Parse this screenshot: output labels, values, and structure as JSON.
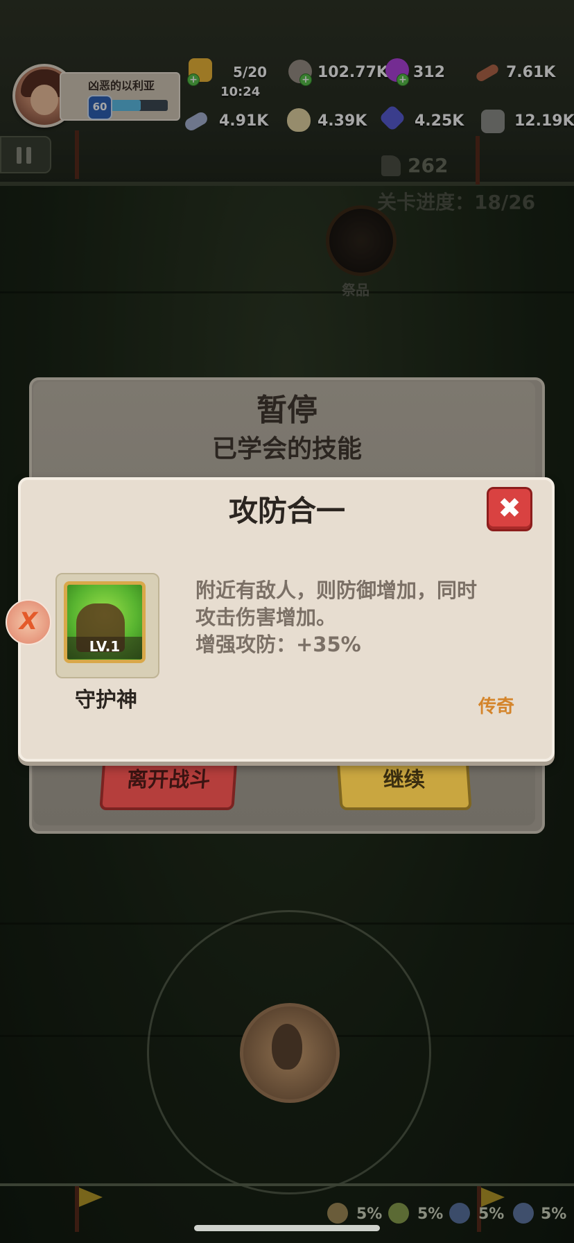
{
  "player": {
    "name": "凶恶的以利亚",
    "level": "60",
    "xp_fraction": 0.55
  },
  "resources": {
    "stamina": {
      "value": "5/20",
      "timer": "10:24",
      "icon": "meat-icon"
    },
    "stone": {
      "value": "102.77K",
      "icon": "stone-icon"
    },
    "orb": {
      "value": "312",
      "icon": "purple-orb-icon"
    },
    "wood": {
      "value": "7.61K",
      "icon": "wood-log-icon"
    },
    "bone": {
      "value": "4.91K",
      "icon": "bone-icon"
    },
    "egg": {
      "value": "4.39K",
      "icon": "egg-icon"
    },
    "crystal": {
      "value": "4.25K",
      "icon": "crystal-icon"
    },
    "ore": {
      "value": "12.19K",
      "icon": "ore-icon"
    }
  },
  "stage": {
    "claw_count": "262",
    "progress": "关卡进度：18/26",
    "offering_label": "祭品"
  },
  "pause_dialog": {
    "title": "暂停",
    "subtitle": "已学会的技能",
    "leave_label": "离开战斗",
    "continue_label": "继续"
  },
  "skill_dialog": {
    "title": "攻防合一",
    "skill_level": "LV.1",
    "skill_name": "守护神",
    "description_line1": "附近有敌人，则防御增加，同时",
    "description_line2": "攻击伤害增加。",
    "description_line3": "增强攻防：+35%",
    "rarity": "传奇",
    "close_icon": "close-x-icon"
  },
  "bottom_stats": [
    {
      "icon": "sun-icon",
      "value": "5%"
    },
    {
      "icon": "leaf-icon",
      "value": "5%"
    },
    {
      "icon": "storm-icon",
      "value": "5%"
    },
    {
      "icon": "wind-icon",
      "value": "5%"
    }
  ],
  "colors": {
    "close_red": "#d94241",
    "leave_red": "#b53e3c",
    "continue_gold": "#c9a640",
    "rarity_orange": "#d4842a",
    "panel_cream": "#e7ddd0"
  }
}
